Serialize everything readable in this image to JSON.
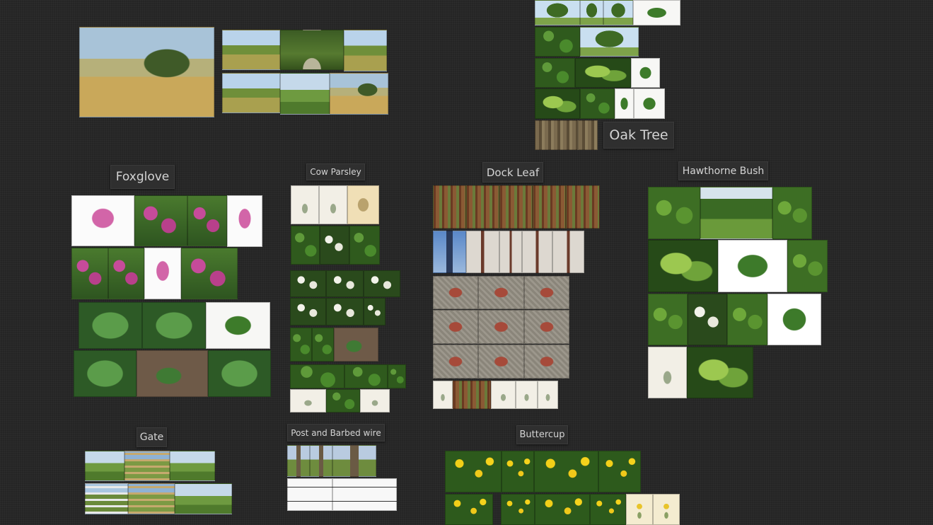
{
  "boards": {
    "oak": {
      "title": "Oak Tree"
    },
    "foxglove": {
      "title": "Foxglove"
    },
    "cow_parsley": {
      "title": "Cow Parsley"
    },
    "dock": {
      "title": "Dock Leaf"
    },
    "hawthorne": {
      "title": "Hawthorne Bush"
    },
    "gate": {
      "title": "Gate"
    },
    "post": {
      "title": "Post and Barbed wire"
    },
    "buttercup": {
      "title": "Buttercup"
    }
  }
}
